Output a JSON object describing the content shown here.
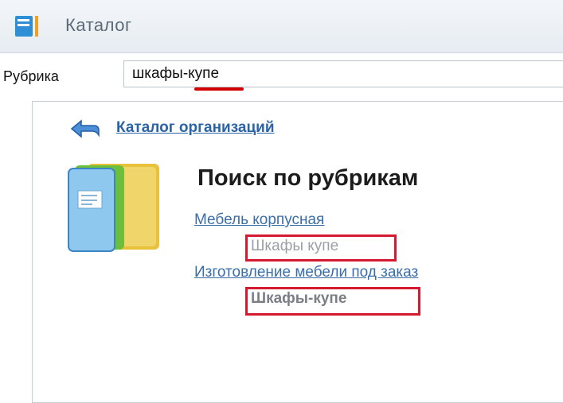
{
  "window": {
    "title": "Каталог",
    "icon": "catalog-icon"
  },
  "rubric": {
    "label": "Рубрика",
    "value": "шкафы-купе"
  },
  "panel": {
    "back_link": "Каталог организаций",
    "heading": "Поиск по рубрикам",
    "results": [
      {
        "category": "Мебель корпусная",
        "subcategory": "Шкафы купе"
      },
      {
        "category": "Изготовление мебели под заказ",
        "subcategory": "Шкафы-купе"
      }
    ]
  },
  "colors": {
    "link": "#3a6ea8",
    "highlight_border": "#d41931",
    "spellcheck": "#d40000"
  }
}
